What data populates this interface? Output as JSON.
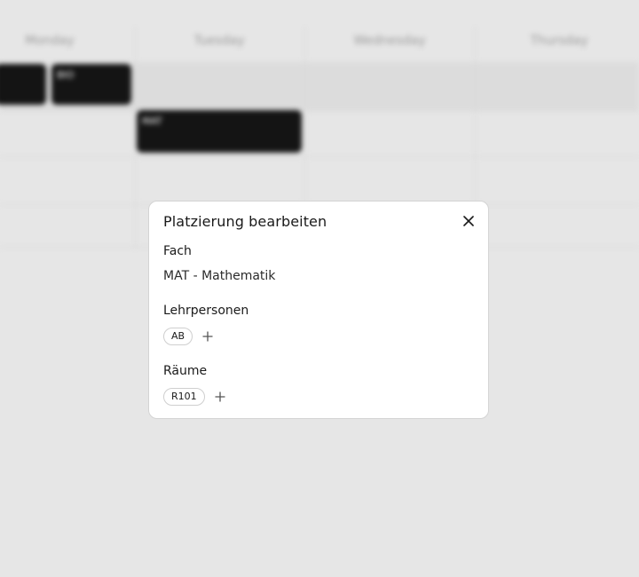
{
  "background": {
    "days": [
      "Monday",
      "Tuesday",
      "Wednesday",
      "Thursday"
    ],
    "blocks": [
      {
        "code": "",
        "extra": ""
      },
      {
        "code": "BIO",
        "extra": ""
      },
      {
        "code": "MAT",
        "extra": ""
      }
    ]
  },
  "dialog": {
    "title": "Platzierung bearbeiten",
    "close_icon": "close-icon",
    "subject": {
      "label": "Fach",
      "value": "MAT - Mathematik"
    },
    "teachers": {
      "label": "Lehrpersonen",
      "chips": [
        "AB"
      ],
      "add_icon": "plus-icon"
    },
    "rooms": {
      "label": "Räume",
      "chips": [
        "R101"
      ],
      "add_icon": "plus-icon"
    }
  },
  "colors": {
    "overlay_bg": "#e6e6e6",
    "dialog_bg": "#ffffff",
    "block_bg": "#141414"
  }
}
